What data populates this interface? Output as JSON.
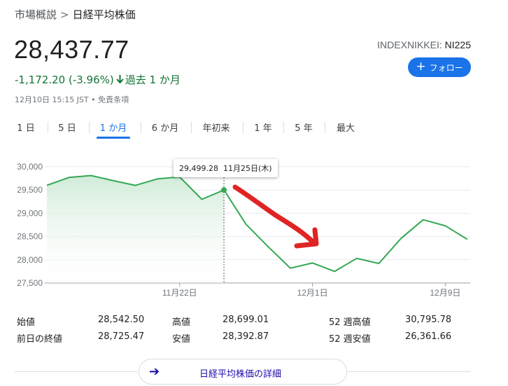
{
  "breadcrumb": {
    "parent": "市場概説",
    "separator": ">",
    "current": "日経平均株価"
  },
  "quote": {
    "price": "28,437.77",
    "change": "-1,172.20 (-3.96%)",
    "period": "過去 1 か月",
    "timestamp": "12月10日 15:15 JST • 免責条項",
    "exchange": "INDEXNIKKEI:",
    "symbol": "NI225"
  },
  "follow_button": {
    "label": "フォロー"
  },
  "tabs": [
    "1 日",
    "5 日",
    "1 か月",
    "6 か月",
    "年初来",
    "1 年",
    "5 年",
    "最大"
  ],
  "active_tab": "1 か月",
  "tooltip": {
    "value": "29,499.28",
    "date": "11月25日(木)"
  },
  "chart_data": {
    "type": "area",
    "y_ticks": [
      "30,000",
      "29,500",
      "29,000",
      "28,500",
      "28,000",
      "27,500"
    ],
    "y_tick_values": [
      30000,
      29500,
      29000,
      28500,
      28000,
      27500
    ],
    "ylim": [
      27500,
      30100
    ],
    "x_tick_labels": [
      "11月22日",
      "12月1日",
      "12月9日"
    ],
    "x_tick_index": [
      6,
      12,
      18
    ],
    "points": [
      29600,
      29770,
      29810,
      29700,
      29600,
      29740,
      29780,
      29300,
      29499.28,
      28760,
      28280,
      27820,
      27930,
      27750,
      28030,
      27920,
      28460,
      28860,
      28730,
      28437.77
    ],
    "highlight_index": 8,
    "line_color": "#34a853",
    "fill_color": "#e6f4ea",
    "annotation_color": "#e02424"
  },
  "stats": [
    {
      "label": "始値",
      "value": "28,542.50",
      "label2": "高値",
      "value2": "28,699.01",
      "label3": "52 週高値",
      "value3": "30,795.78"
    },
    {
      "label": "前日の終値",
      "value": "28,725.47",
      "label2": "安値",
      "value2": "28,392.87",
      "label3": "52 週安値",
      "value3": "26,361.66"
    }
  ],
  "detail_button": {
    "label": "日経平均株価の詳細"
  }
}
